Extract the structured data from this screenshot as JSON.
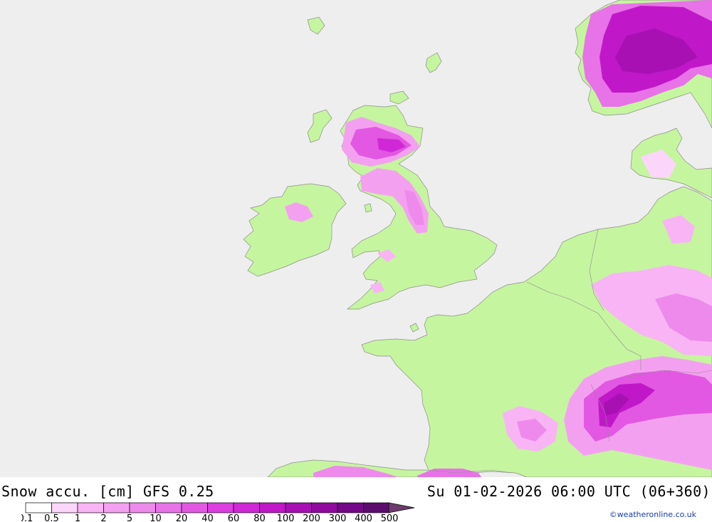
{
  "map": {
    "title": "Snow accu. [cm] GFS 0.25",
    "valid_time": "Su 01-02-2026 06:00 UTC (06+360)",
    "credit": "©weatheronline.co.uk",
    "colors": {
      "sea": "#eeeeee",
      "land": "#c6f5a0",
      "coastline": "#8c8c8c"
    }
  },
  "legend": {
    "unit": "cm",
    "labels": [
      "0.1",
      "0.5",
      "1",
      "2",
      "5",
      "10",
      "20",
      "40",
      "60",
      "80",
      "100",
      "200",
      "300",
      "400",
      "500"
    ],
    "colors": [
      "#ffffff",
      "#fcd6fa",
      "#f8b4f4",
      "#f4a0f0",
      "#ee8aec",
      "#e872e8",
      "#e258e2",
      "#dc3ee0",
      "#d028d6",
      "#c018c8",
      "#a810b4",
      "#900aa0",
      "#740888",
      "#5c0c6e",
      "#6c3c6e"
    ]
  }
}
